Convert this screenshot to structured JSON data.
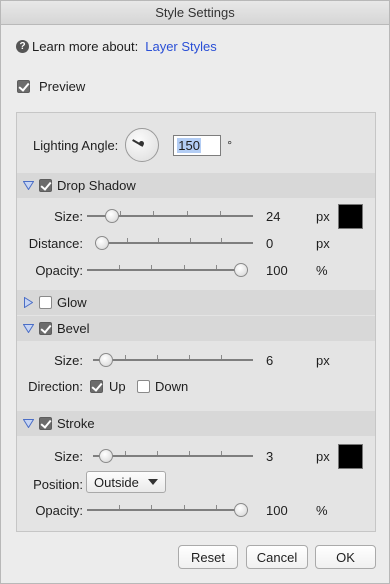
{
  "window": {
    "title": "Style Settings"
  },
  "help": {
    "prefix": "Learn more about:",
    "link": "Layer Styles",
    "icon": "question-circle-icon"
  },
  "preview": {
    "label": "Preview",
    "checked": true
  },
  "lighting": {
    "label": "Lighting Angle:",
    "value": "150",
    "unit": "°"
  },
  "drop_shadow": {
    "title": "Drop Shadow",
    "enabled": true,
    "expanded": true,
    "size": {
      "label": "Size:",
      "value": "24",
      "unit": "px",
      "fraction": 0.12
    },
    "distance": {
      "label": "Distance:",
      "value": "0",
      "unit": "px",
      "fraction": 0.0
    },
    "opacity": {
      "label": "Opacity:",
      "value": "100",
      "unit": "%",
      "fraction": 1.0
    },
    "color": "#000000"
  },
  "glow": {
    "title": "Glow",
    "enabled": false,
    "expanded": false
  },
  "bevel": {
    "title": "Bevel",
    "enabled": true,
    "expanded": true,
    "size": {
      "label": "Size:",
      "value": "6",
      "unit": "px",
      "fraction": 0.04
    },
    "direction": {
      "label": "Direction:",
      "up_label": "Up",
      "up_checked": true,
      "down_label": "Down",
      "down_checked": false
    }
  },
  "stroke": {
    "title": "Stroke",
    "enabled": true,
    "expanded": true,
    "size": {
      "label": "Size:",
      "value": "3",
      "unit": "px",
      "fraction": 0.04
    },
    "color": "#000000",
    "position": {
      "label": "Position:",
      "selected": "Outside"
    },
    "opacity": {
      "label": "Opacity:",
      "value": "100",
      "unit": "%",
      "fraction": 1.0
    }
  },
  "buttons": {
    "reset": "Reset",
    "cancel": "Cancel",
    "ok": "OK"
  }
}
